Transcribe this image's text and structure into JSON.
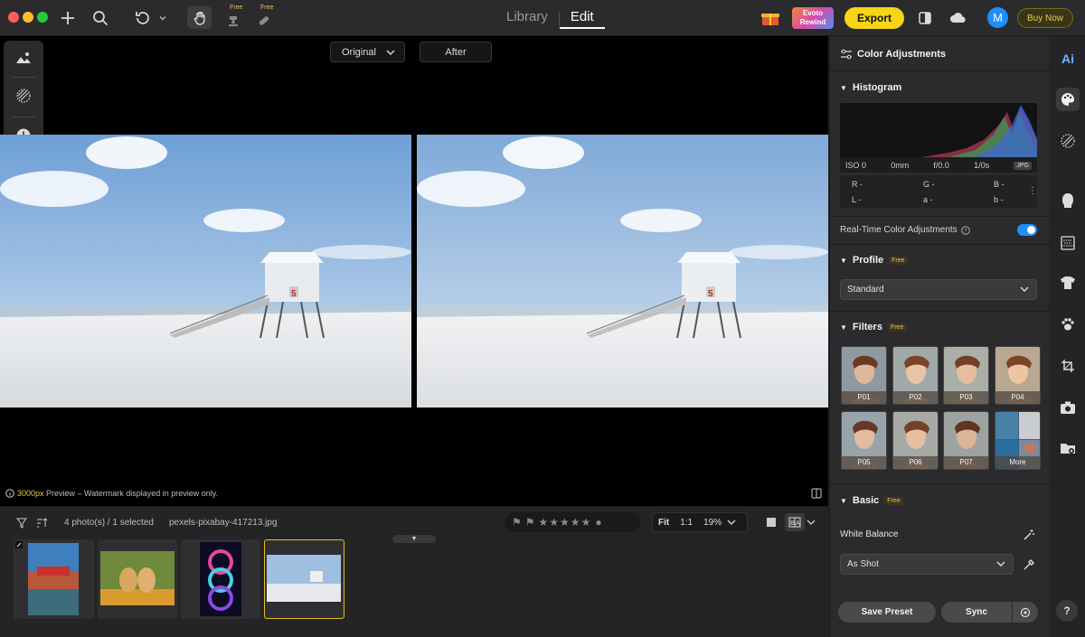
{
  "topbar": {
    "tabs": [
      {
        "label": "Library"
      },
      {
        "label": "Edit"
      }
    ],
    "free_label": "Free",
    "rewind_line1": "Evoto",
    "rewind_line2": "Rewind",
    "export_label": "Export",
    "avatar_initial": "M",
    "buy_now_label": "Buy Now"
  },
  "canvas": {
    "view_mode": "Original",
    "after_label": "After",
    "preview_size": "3000px",
    "preview_note": " Preview – Watermark displayed in preview only."
  },
  "filmstrip": {
    "photo_count": "4 photo(s) / 1 selected",
    "filename": "pexels-pixabay-417213.jpg",
    "zoom_fit": "Fit",
    "zoom_1to1": "1:1",
    "zoom_level": "19%"
  },
  "panel": {
    "title": "Color Adjustments",
    "histogram": {
      "title": "Histogram",
      "iso": "ISO 0",
      "focal": "0mm",
      "aperture": "f/0.0",
      "shutter": "1/0s",
      "format": "JPG",
      "r": "R -",
      "g": "G -",
      "b": "B -",
      "l": "L -",
      "a": "a -",
      "bb": "b -"
    },
    "realtime_label": "Real-Time Color Adjustments",
    "realtime_on": true,
    "profile": {
      "title": "Profile",
      "tag": "Free",
      "value": "Standard"
    },
    "filters": {
      "title": "Filters",
      "tag": "Free",
      "items": [
        "P01",
        "P02",
        "P03",
        "P04",
        "P05",
        "P06",
        "P07",
        "More"
      ]
    },
    "basic": {
      "title": "Basic",
      "tag": "Free"
    },
    "white_balance": {
      "label": "White Balance",
      "value": "As Shot"
    },
    "save_preset_label": "Save Preset",
    "sync_label": "Sync"
  },
  "rail": {
    "ai_label": "Ai",
    "help_label": "?"
  },
  "colors": {
    "accent_yellow": "#f7d418",
    "toggle_blue": "#1e8fff",
    "panel_bg": "#2b2b2d"
  }
}
